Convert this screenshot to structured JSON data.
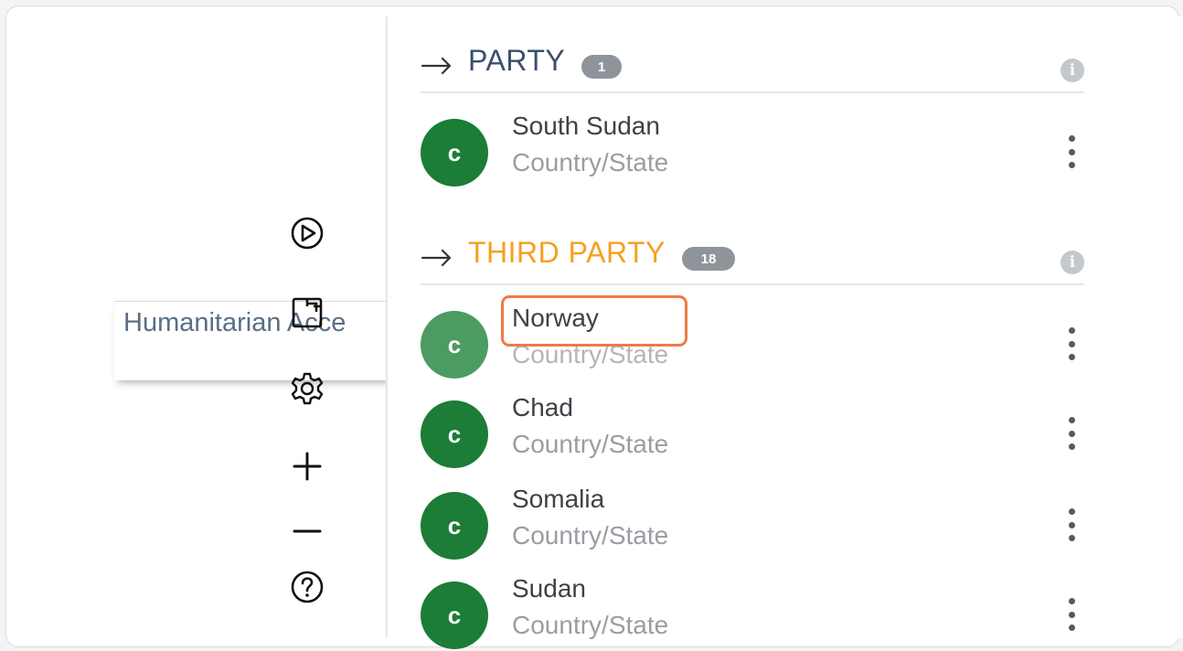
{
  "canvas": {
    "node_label": "Humanitarian Acce"
  },
  "toolbar": {
    "icons": [
      "play-circle-icon",
      "fit-screen-icon",
      "settings-icon",
      "zoom-in-icon",
      "zoom-out-icon",
      "help-icon"
    ]
  },
  "panel": {
    "party": {
      "title": "PARTY",
      "count": "1",
      "title_color": "#3a4f6b",
      "items": [
        {
          "avatar": "c",
          "name": "South Sudan",
          "type": "Country/State"
        }
      ]
    },
    "third_party": {
      "title": "THIRD PARTY",
      "count": "18",
      "title_color": "#f5a01f",
      "items": [
        {
          "avatar": "c",
          "name": "Norway",
          "type": "Country/State",
          "highlighted": true
        },
        {
          "avatar": "c",
          "name": "Chad",
          "type": "Country/State"
        },
        {
          "avatar": "c",
          "name": "Somalia",
          "type": "Country/State"
        },
        {
          "avatar": "c",
          "name": "Sudan",
          "type": "Country/State"
        }
      ]
    }
  },
  "colors": {
    "avatar": "#1b7d36",
    "highlight_border": "#f07a45",
    "badge": "#8f949b"
  }
}
